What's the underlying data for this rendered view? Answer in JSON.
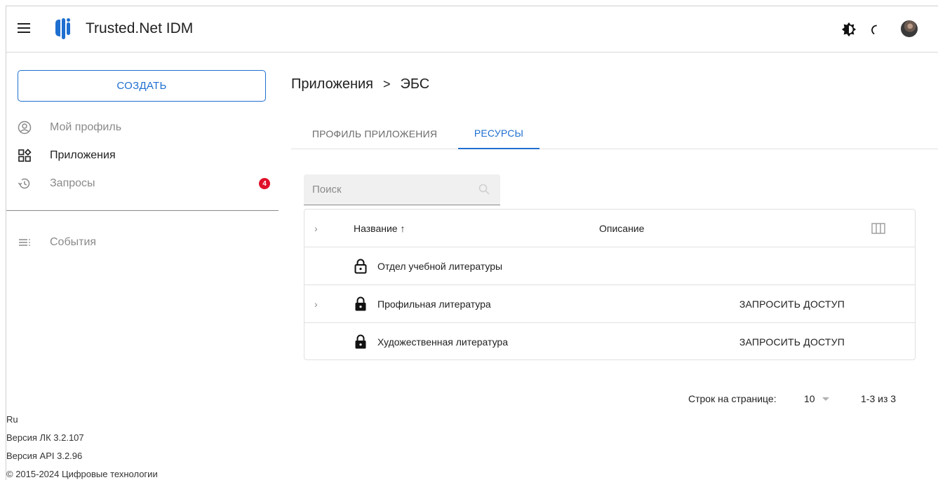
{
  "header": {
    "app_title": "Trusted.Net IDM",
    "icons": [
      "menu-icon",
      "logo-icon",
      "theme-toggle-icon",
      "loading-spinner-icon",
      "avatar"
    ]
  },
  "sidebar": {
    "create_label": "СОЗДАТЬ",
    "items": [
      {
        "label": "Мой профиль",
        "icon": "account-circle-icon"
      },
      {
        "label": "Приложения",
        "icon": "apps-grid-icon"
      },
      {
        "label": "Запросы",
        "icon": "history-icon",
        "badge": "4"
      },
      {
        "label": "События",
        "icon": "list-icon"
      }
    ],
    "footer": {
      "language": "Ru",
      "lk_version": "Версия ЛК 3.2.107",
      "api_version": "Версия API 3.2.96",
      "copyright": "© 2015-2024 Цифровые технологии"
    }
  },
  "main": {
    "breadcrumb": {
      "parent": "Приложения",
      "separator": ">",
      "current": "ЭБС"
    },
    "tabs": [
      {
        "label": "ПРОФИЛЬ ПРИЛОЖЕНИЯ",
        "active": false
      },
      {
        "label": "РЕСУРСЫ",
        "active": true
      }
    ],
    "search": {
      "placeholder": "Поиск"
    },
    "table": {
      "columns": {
        "name": "Название ↑",
        "description": "Описание"
      },
      "rows": [
        {
          "name": "Отдел учебной литературы",
          "lock": "unlocked",
          "expandable": false,
          "action": ""
        },
        {
          "name": "Профильная литература",
          "lock": "locked",
          "expandable": true,
          "action": "ЗАПРОСИТЬ ДОСТУП"
        },
        {
          "name": "Художественная литература",
          "lock": "locked",
          "expandable": false,
          "action": "ЗАПРОСИТЬ ДОСТУП"
        }
      ]
    },
    "pagination": {
      "rows_label": "Строк на странице:",
      "rows_value": "10",
      "range": "1-3 из 3"
    }
  },
  "colors": {
    "accent": "#1e6fd0",
    "badge": "#e0102a",
    "muted": "#8a8a8a"
  }
}
